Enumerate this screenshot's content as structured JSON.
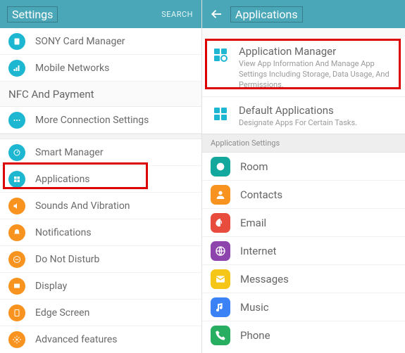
{
  "left": {
    "header": {
      "title": "Settings",
      "search": "SEARCH"
    },
    "rows_top": [
      {
        "label": "SONY Card Manager"
      },
      {
        "label": "Mobile Networks"
      }
    ],
    "category": "NFC And Payment",
    "rows_mid": [
      {
        "label": "More Connection Settings"
      }
    ],
    "rows_bot": [
      {
        "label": "Smart Manager"
      },
      {
        "label": "Applications"
      },
      {
        "label": "Sounds And Vibration"
      },
      {
        "label": "Notifications"
      },
      {
        "label": "Do Not Disturb"
      },
      {
        "label": "Display"
      },
      {
        "label": "Edge Screen"
      },
      {
        "label": "Advanced features"
      }
    ]
  },
  "right": {
    "header": {
      "title": "Applications"
    },
    "cards": [
      {
        "title": "Application Manager",
        "desc": "View App Information And Manage App Settings Including Storage, Data Usage, And Permissions."
      },
      {
        "title": "Default Applications",
        "desc": "Designate Apps For Certain Tasks."
      }
    ],
    "section": "Application Settings",
    "apps": [
      {
        "label": "Room"
      },
      {
        "label": "Contacts"
      },
      {
        "label": "Email"
      },
      {
        "label": "Internet"
      },
      {
        "label": "Messages"
      },
      {
        "label": "Music"
      },
      {
        "label": "Phone"
      }
    ]
  }
}
